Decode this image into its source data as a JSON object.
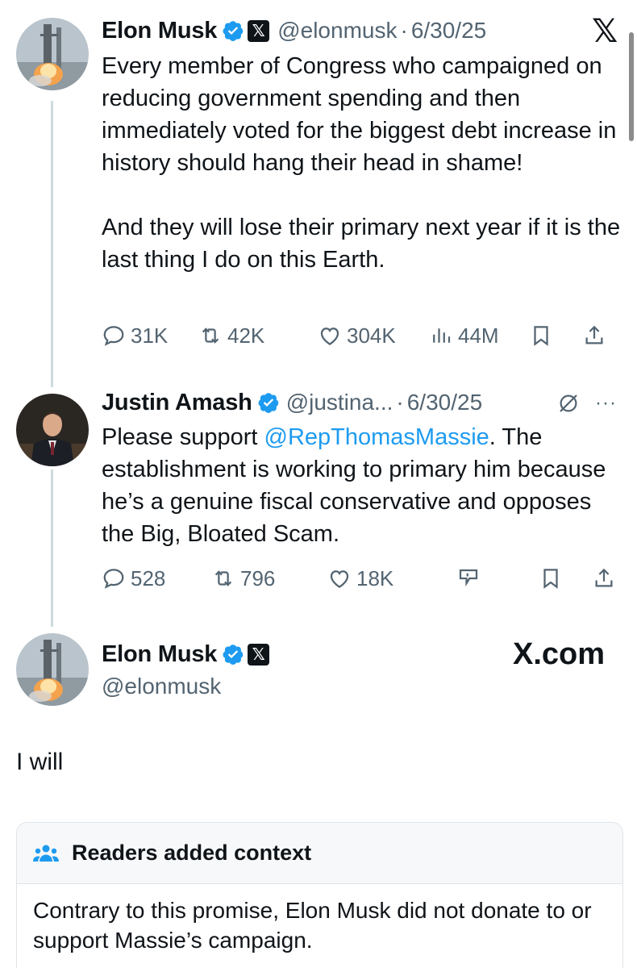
{
  "tweet1": {
    "name": "Elon Musk",
    "handle": "@elonmusk",
    "dot": "·",
    "date": "6/30/25",
    "text": "Every member of Congress who campaigned on reducing government spending and then immediately voted for the biggest debt increase in history should hang their head in shame!\n\nAnd they will lose their primary next year if it is the last thing I do on this Earth.",
    "replies": "31K",
    "reposts": "42K",
    "likes": "304K",
    "views": "44M"
  },
  "tweet2": {
    "name": "Justin Amash",
    "handle": "@justina...",
    "dot": "·",
    "date": "6/30/25",
    "text_before": "Please support ",
    "mention": "@RepThomasMassie",
    "text_after": ". The establishment is working to primary him because he’s a genuine fiscal conservative and opposes the Big, Bloated Scam.",
    "replies": "528",
    "reposts": "796",
    "likes": "18K",
    "more": "···"
  },
  "tweet3": {
    "name": "Elon Musk",
    "handle": "@elonmusk",
    "brand": "X.com",
    "text": "I will"
  },
  "context": {
    "title": "Readers added context",
    "text": "Contrary to this promise, Elon Musk did not donate to or support Massie’s campaign."
  },
  "colors": {
    "accent": "#1d9bf0",
    "secondary_text": "#536471",
    "thread_line": "#cfd9de"
  },
  "icons": [
    "verified-badge-icon",
    "x-affiliate-icon",
    "x-logo-icon",
    "reply-icon",
    "repost-icon",
    "like-icon",
    "views-icon",
    "bookmark-icon",
    "share-icon",
    "grok-icon",
    "more-icon",
    "people-icon"
  ]
}
